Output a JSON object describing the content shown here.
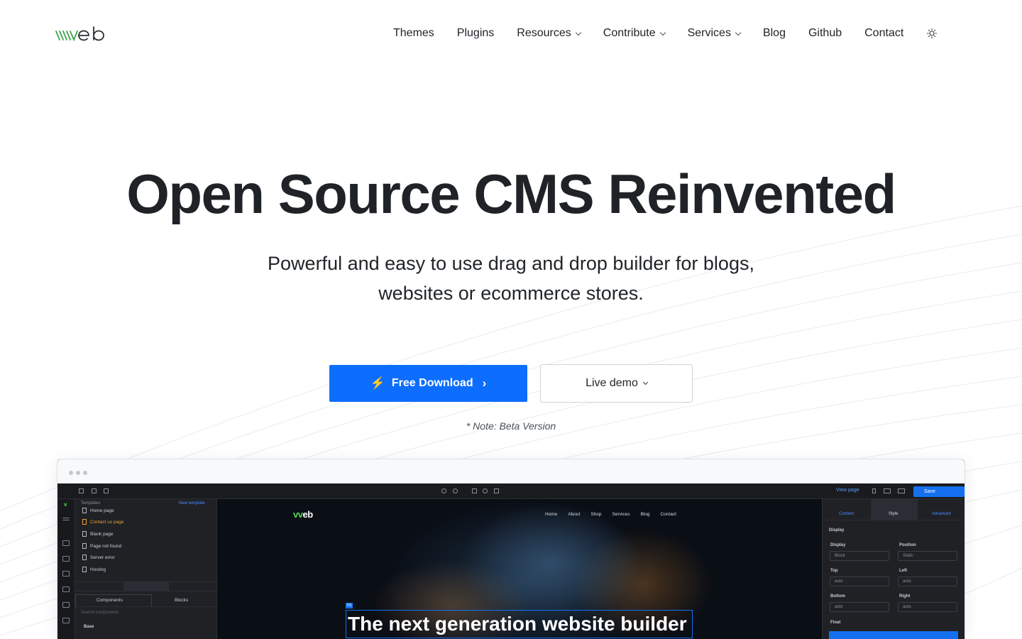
{
  "brand": {
    "logo_text": "vvveb"
  },
  "nav": {
    "items": [
      {
        "label": "Themes",
        "dropdown": false
      },
      {
        "label": "Plugins",
        "dropdown": false
      },
      {
        "label": "Resources",
        "dropdown": true
      },
      {
        "label": "Contribute",
        "dropdown": true
      },
      {
        "label": "Services",
        "dropdown": true
      },
      {
        "label": "Blog",
        "dropdown": false
      },
      {
        "label": "Github",
        "dropdown": false
      },
      {
        "label": "Contact",
        "dropdown": false
      }
    ],
    "theme_icon": "sun-icon"
  },
  "hero": {
    "title": "Open Source CMS Reinvented",
    "subtitle": "Powerful and easy to use drag and drop builder for blogs, websites or ecommerce stores.",
    "primary_button": "Free Download",
    "secondary_button": "Live demo",
    "note": "* Note: Beta Version"
  },
  "editor": {
    "view_page": "View page",
    "save": "Save",
    "templates_heading": "Templates",
    "new_template": "New template",
    "templates": [
      {
        "label": "Home page",
        "active": false
      },
      {
        "label": "Contact us page",
        "active": true
      },
      {
        "label": "Blank page",
        "active": false
      },
      {
        "label": "Page not found",
        "active": false
      },
      {
        "label": "Server error",
        "active": false
      },
      {
        "label": "Hosting",
        "active": false
      }
    ],
    "components_tab": "Components",
    "blocks_tab": "Blocks",
    "search_placeholder": "Search components",
    "base_label": "Base",
    "canvas": {
      "logo": "vveb",
      "nav": [
        "Home",
        "About",
        "Shop",
        "Services",
        "Blog",
        "Contact"
      ],
      "h1_tag": "H1",
      "headline": "The next generation website builder"
    },
    "right_panel": {
      "tabs": [
        "Content",
        "Style",
        "Advanced"
      ],
      "section": "Display",
      "fields": [
        {
          "label": "Display",
          "value": "Block"
        },
        {
          "label": "Position",
          "value": "Static"
        },
        {
          "label": "Top",
          "value": "auto"
        },
        {
          "label": "Left",
          "value": "auto"
        },
        {
          "label": "Bottom",
          "value": "auto"
        },
        {
          "label": "Right",
          "value": "auto"
        }
      ],
      "float_label": "Float"
    }
  },
  "colors": {
    "primary": "#0d6efd",
    "logo_green": "#3fa34d",
    "text": "#212529"
  }
}
